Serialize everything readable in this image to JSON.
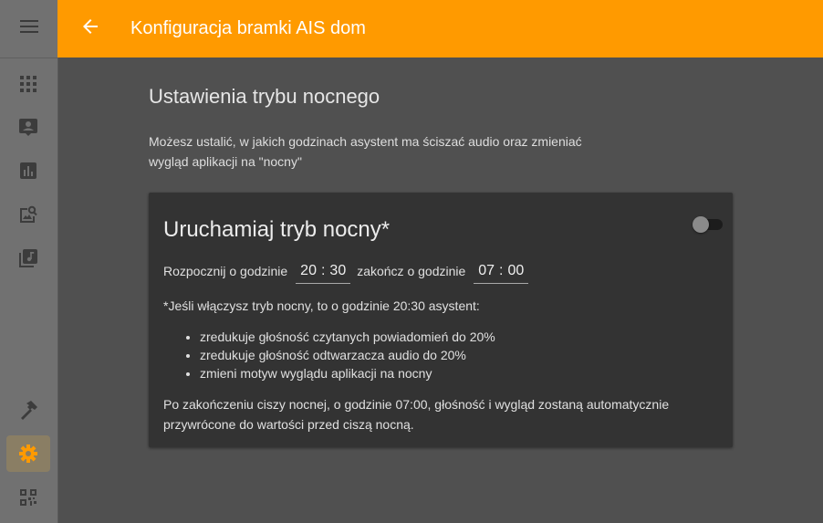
{
  "header": {
    "title": "Konfiguracja bramki AIS dom"
  },
  "page": {
    "title": "Ustawienia trybu nocnego",
    "description": "Możesz ustalić, w jakich godzinach asystent ma ściszać audio oraz zmieniać wygląd aplikacji na \"nocny\""
  },
  "card": {
    "title": "Uruchamiaj tryb nocny*",
    "toggle_on": false,
    "start_label": "Rozpocznij o godzinie",
    "start_hour": "20",
    "start_minute": "30",
    "end_label": "zakończ o godzinie",
    "end_hour": "07",
    "end_minute": "00",
    "time_separator": ":",
    "note": "*Jeśli włączysz tryb nocny, to o godzinie 20:30 asystent:",
    "effects": [
      "zredukuje głośność czytanych powiadomień do 20%",
      "zredukuje głośność odtwarzacza audio do 20%",
      "zmieni motyw wyglądu aplikacji na nocny"
    ],
    "footer": "Po zakończeniu ciszy nocnej, o godzinie 07:00, głośność i wygląd zostaną automatycznie przywrócone do wartości przed ciszą nocną."
  },
  "sidebar": {
    "icons": [
      "apps-icon",
      "account-box-icon",
      "chart-icon",
      "image-search-icon",
      "library-music-icon",
      "hammer-icon",
      "settings-icon",
      "qrcode-icon"
    ],
    "active": "settings-icon"
  },
  "colors": {
    "accent": "#ff9a00",
    "background": "#505050",
    "sidebar": "#717171",
    "card": "#333333"
  }
}
